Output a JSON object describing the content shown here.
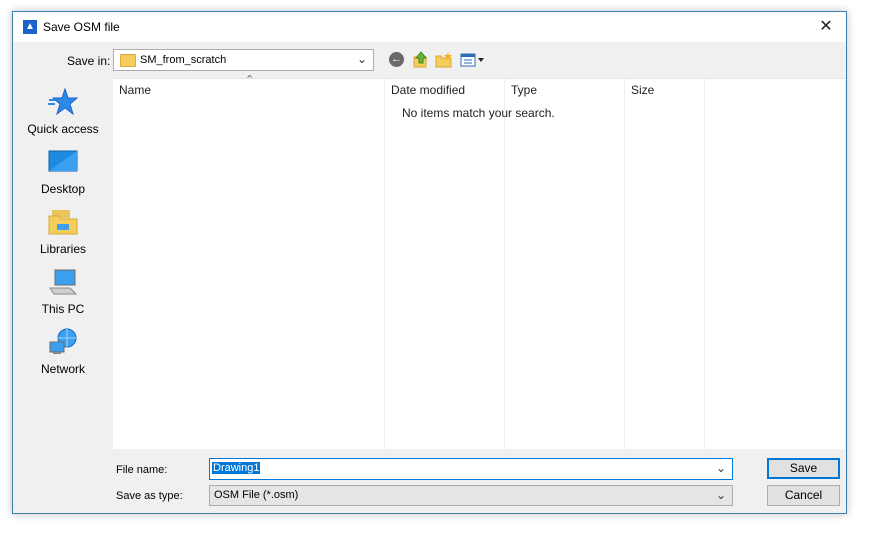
{
  "window": {
    "title": "Save OSM file",
    "app_icon_glyph": "▲",
    "close_glyph": "✕"
  },
  "toolbar": {
    "save_in_label": "Save in:",
    "save_in_value": "SM_from_scratch",
    "icons": [
      "back-icon",
      "up-folder-icon",
      "new-folder-icon",
      "view-menu-icon"
    ]
  },
  "places": [
    {
      "label": "Quick access",
      "icon": "star-icon"
    },
    {
      "label": "Desktop",
      "icon": "desktop-icon"
    },
    {
      "label": "Libraries",
      "icon": "libraries-icon"
    },
    {
      "label": "This PC",
      "icon": "computer-icon"
    },
    {
      "label": "Network",
      "icon": "network-icon"
    }
  ],
  "list": {
    "columns": [
      "Name",
      "Date modified",
      "Type",
      "Size"
    ],
    "empty_message": "No items match your search."
  },
  "form": {
    "file_name_label": "File name:",
    "file_name_value": "Drawing1",
    "save_as_type_label": "Save as type:",
    "save_as_type_value": "OSM File (*.osm)"
  },
  "buttons": {
    "save": "Save",
    "cancel": "Cancel"
  },
  "colors": {
    "accent": "#0078d7",
    "folder": "#f5cd5a",
    "frame": "#3c7fb1"
  }
}
